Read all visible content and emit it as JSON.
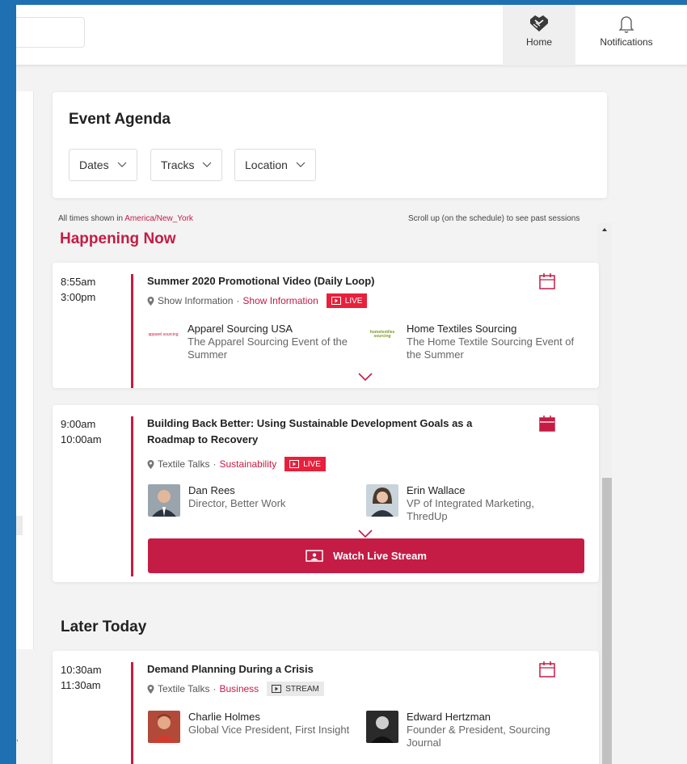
{
  "topbar": {
    "nav": [
      {
        "label": "Home",
        "icon": "handshake-icon"
      },
      {
        "label": "Notifications",
        "icon": "bell-icon"
      }
    ]
  },
  "agenda": {
    "title": "Event Agenda",
    "filters": [
      "Dates",
      "Tracks",
      "Location"
    ]
  },
  "notes": {
    "times_prefix": "All times shown in",
    "timezone": "America/New_York",
    "scroll_hint": "Scroll up (on the schedule) to see past sessions"
  },
  "sections": {
    "happening_now": "Happening Now",
    "later_today": "Later Today"
  },
  "sessions": [
    {
      "start": "8:55am",
      "end": "3:00pm",
      "title": "Summer 2020 Promotional Video (Daily Loop)",
      "location": "Show Information",
      "track": "Show Information",
      "badge": "LIVE",
      "people": [
        {
          "name": "Apparel Sourcing USA",
          "role": "The Apparel Sourcing Event of the Summer",
          "logo_text": "apparel sourcing"
        },
        {
          "name": "Home Textiles Sourcing",
          "role": "The Home Textile Sourcing Event of the Summer",
          "logo_text": "hometextiles sourcing"
        }
      ]
    },
    {
      "start": "9:00am",
      "end": "10:00am",
      "title": "Building Back Better: Using Sustainable Development Goals as a Roadmap to Recovery",
      "location": "Textile Talks",
      "track": "Sustainability",
      "badge": "LIVE",
      "people": [
        {
          "name": "Dan Rees",
          "role": "Director, Better Work"
        },
        {
          "name": "Erin Wallace",
          "role": "VP of Integrated Marketing, ThredUp"
        }
      ],
      "action": "Watch Live Stream"
    },
    {
      "start": "10:30am",
      "end": "11:30am",
      "title": "Demand Planning During a Crisis",
      "location": "Textile Talks",
      "track": "Business",
      "badge": "STREAM",
      "people": [
        {
          "name": "Charlie Holmes",
          "role": "Global Vice President, First Insight"
        },
        {
          "name": "Edward Hertzman",
          "role": "Founder & President, Sourcing Journal"
        }
      ]
    }
  ],
  "colors": {
    "accent": "#c41c45",
    "live_badge": "#e8203c",
    "background": "#f3f3f3",
    "frame": "#1f6fb3"
  }
}
